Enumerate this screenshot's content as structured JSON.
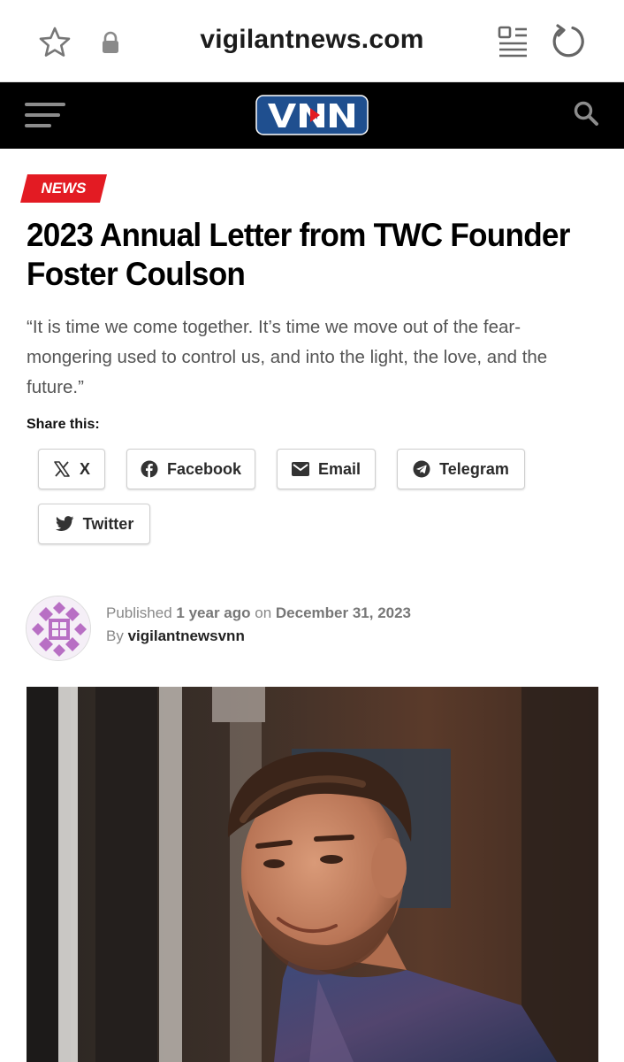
{
  "browser": {
    "url": "vigilantnews.com",
    "icons": [
      "star-icon",
      "lock-icon",
      "reader-mode-icon",
      "reload-icon"
    ]
  },
  "site": {
    "logo_text": "VNN",
    "colors": {
      "header_bg": "#000000",
      "logo_bg": "#1f4f8f",
      "accent": "#e31b23"
    },
    "icons": [
      "hamburger-menu-icon",
      "search-icon"
    ]
  },
  "article": {
    "category": "NEWS",
    "title": "2023 Annual Letter from TWC Founder Foster Coulson",
    "dek": "“It is time we come together. It’s time we move out of the fear-mongering used to control us, and into the light, the love, and the future.”",
    "share_label": "Share this:",
    "share_buttons": [
      {
        "label": "X",
        "icon": "x-logo-icon"
      },
      {
        "label": "Facebook",
        "icon": "facebook-icon"
      },
      {
        "label": "Email",
        "icon": "email-icon"
      },
      {
        "label": "Telegram",
        "icon": "telegram-icon"
      },
      {
        "label": "Twitter",
        "icon": "twitter-icon"
      }
    ],
    "byline": {
      "published_prefix": "Published",
      "relative_time": "1 year ago",
      "on_word": "on",
      "date": "December 31, 2023",
      "by_prefix": "By",
      "author": "vigilantnewsvnn"
    }
  }
}
